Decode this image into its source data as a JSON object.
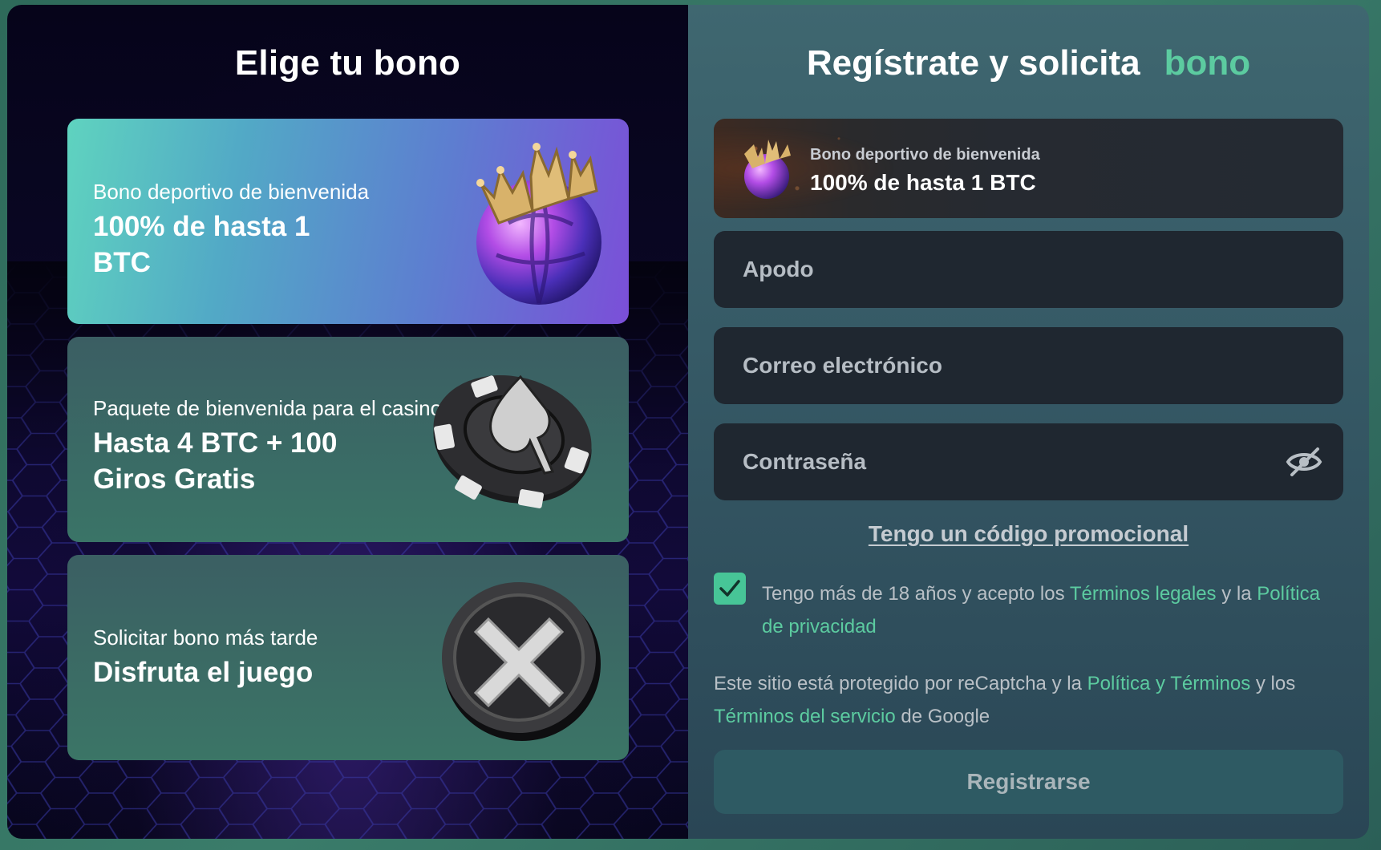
{
  "left": {
    "title": "Elige tu bono",
    "cards": [
      {
        "subtitle": "Bono deportivo de bienvenida",
        "headline": "100% de hasta 1 BTC",
        "art": "crowned-soccer-ball-icon"
      },
      {
        "subtitle": "Paquete de bienvenida para el casino",
        "headline": "Hasta 4 BTC + 100 Giros Gratis",
        "art": "poker-chip-spade-icon"
      },
      {
        "subtitle": "Solicitar bono más tarde",
        "headline": "Disfruta el juego",
        "art": "x-coin-icon"
      }
    ]
  },
  "right": {
    "title_main": "Regístrate y solicita",
    "title_accent": "bono",
    "selected_bonus": {
      "subtitle": "Bono deportivo de bienvenida",
      "headline": "100% de hasta 1 BTC"
    },
    "fields": {
      "nickname_placeholder": "Apodo",
      "email_placeholder": "Correo electrónico",
      "password_placeholder": "Contraseña"
    },
    "promo_link": "Tengo un código promocional",
    "terms": {
      "checked": true,
      "text_before": "Tengo más de 18 años y acepto los ",
      "legal_link": "Términos legales",
      "text_mid": " y la ",
      "privacy_link": "Política de privacidad"
    },
    "captcha": {
      "text_before": "Este sitio está protegido por reCaptcha y la ",
      "policy_link": "Política y Términos",
      "text_mid": " y los ",
      "service_link": "Términos del servicio",
      "text_after": " de Google"
    },
    "register_label": "Registrarse"
  },
  "colors": {
    "accent_green": "#5ccba0",
    "checkbox_green": "#47c597",
    "field_bg": "#1f2730",
    "register_bg": "#2e5a63"
  }
}
